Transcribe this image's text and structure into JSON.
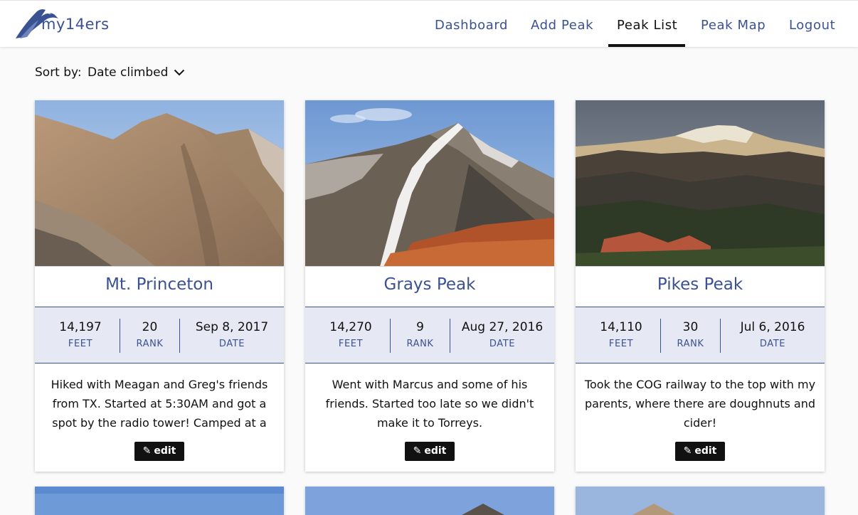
{
  "brand": {
    "name": "my14ers"
  },
  "nav": {
    "items": [
      {
        "label": "Dashboard"
      },
      {
        "label": "Add Peak"
      },
      {
        "label": "Peak List",
        "active": true
      },
      {
        "label": "Peak Map"
      },
      {
        "label": "Logout"
      }
    ]
  },
  "sort": {
    "label": "Sort by:",
    "value": "Date climbed",
    "icon": "chevron-down-icon"
  },
  "stat_labels": {
    "feet": "FEET",
    "rank": "RANK",
    "date": "DATE"
  },
  "cards": [
    {
      "name": "Mt. Princeton",
      "feet": "14,197",
      "rank": "20",
      "date": "Sep 8, 2017",
      "description": "Hiked with Meagan and Greg's friends from TX. Started at 5:30AM and got a spot by the radio tower! Camped at a",
      "edit_label": "edit"
    },
    {
      "name": "Grays Peak",
      "feet": "14,270",
      "rank": "9",
      "date": "Aug 27, 2016",
      "description": "Went with Marcus and some of his friends. Started too late so we didn't make it to Torreys.",
      "edit_label": "edit"
    },
    {
      "name": "Pikes Peak",
      "feet": "14,110",
      "rank": "30",
      "date": "Jul 6, 2016",
      "description": "Took the COG railway to the top with my parents, where there are doughnuts and cider!",
      "edit_label": "edit"
    }
  ],
  "colors": {
    "accent": "#3a5192",
    "stats_bg": "#e6e9f4",
    "edit_bg": "#111111"
  }
}
